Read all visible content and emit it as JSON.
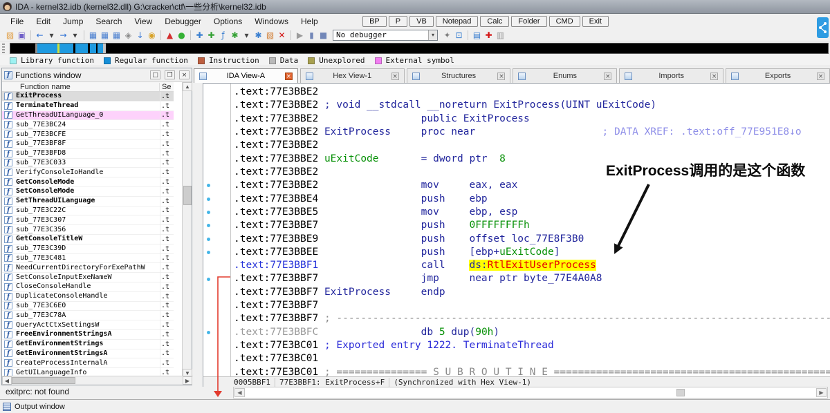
{
  "window": {
    "title": "IDA - kernel32.idb (kernel32.dll) G:\\cracker\\ctf\\一些分析\\kernel32.idb"
  },
  "menu": {
    "items": [
      "File",
      "Edit",
      "Jump",
      "Search",
      "View",
      "Debugger",
      "Options",
      "Windows",
      "Help"
    ],
    "quick_buttons": [
      "BP",
      "P",
      "VB",
      "Notepad",
      "Calc",
      "Folder",
      "CMD",
      "Exit"
    ]
  },
  "toolbar": {
    "debugger_select": "No debugger",
    "left_icons": [
      {
        "name": "open-file-icon",
        "glyph": "▨",
        "color": "#e09a3c"
      },
      {
        "name": "save-icon",
        "glyph": "▣",
        "color": "#7161c8"
      },
      {
        "sep": true
      },
      {
        "name": "navigate-back-icon",
        "glyph": "←",
        "color": "#2b6fd4"
      },
      {
        "name": "navigate-back-dropdown-icon",
        "glyph": "▾",
        "color": "#444444"
      },
      {
        "name": "navigate-forward-icon",
        "glyph": "→",
        "color": "#2b6fd4"
      },
      {
        "name": "navigate-forward-dropdown-icon",
        "glyph": "▾",
        "color": "#444444"
      },
      {
        "sep": true
      },
      {
        "name": "jump-to-address-icon",
        "glyph": "▦",
        "color": "#4a7fd0"
      },
      {
        "name": "jump-to-name-icon",
        "glyph": "▦",
        "color": "#4a7fd0"
      },
      {
        "name": "jump-to-function-icon",
        "glyph": "▦",
        "color": "#4a7fd0"
      },
      {
        "name": "jump-xref-icon",
        "glyph": "◈",
        "color": "#8a8a8a"
      },
      {
        "name": "jump-down-icon",
        "glyph": "↓",
        "color": "#2b6fd4"
      },
      {
        "name": "search-icon",
        "glyph": "◉",
        "color": "#d8a32a"
      },
      {
        "sep": true
      },
      {
        "name": "problems-icon",
        "glyph": "▲",
        "color": "#d33030"
      },
      {
        "name": "analysis-indicator-icon",
        "glyph": "●",
        "color": "#35b135"
      },
      {
        "sep": true
      },
      {
        "name": "create-struct-icon",
        "glyph": "✚",
        "color": "#3a7fd0"
      },
      {
        "name": "create-enum-icon",
        "glyph": "✚",
        "color": "#35a135"
      },
      {
        "name": "rename-icon",
        "glyph": "ƒ",
        "color": "#3a7fd0"
      },
      {
        "name": "patch-icon",
        "glyph": "✱",
        "color": "#35a135"
      },
      {
        "name": "patch-dropdown-icon",
        "glyph": "▾",
        "color": "#444444"
      },
      {
        "name": "snippets-icon",
        "glyph": "✱",
        "color": "#3a7fd0"
      },
      {
        "name": "colors-icon",
        "glyph": "▧",
        "color": "#d07a2e"
      },
      {
        "name": "undefine-icon",
        "glyph": "✕",
        "color": "#d41616"
      },
      {
        "sep": true
      },
      {
        "name": "debug-start-icon",
        "glyph": "▶",
        "color": "#9b9b9b"
      },
      {
        "name": "debug-pause-icon",
        "glyph": "▮",
        "color": "#7287b8"
      },
      {
        "name": "debug-stop-icon",
        "glyph": "■",
        "color": "#7287b8"
      }
    ],
    "right_icons": [
      {
        "name": "debugger-options-icon",
        "glyph": "✦",
        "color": "#808080"
      },
      {
        "name": "open-subviews-icon",
        "glyph": "⊡",
        "color": "#3a7fd0"
      },
      {
        "sep": true
      },
      {
        "name": "script-window-icon",
        "glyph": "▤",
        "color": "#3a7fd0"
      },
      {
        "name": "breakpoint-add-icon",
        "glyph": "✚",
        "color": "#d41616"
      },
      {
        "name": "breakpoint-remove-icon",
        "glyph": "▥",
        "color": "#9b9b9b"
      }
    ]
  },
  "legend": {
    "items": [
      {
        "label": "Library function",
        "color": "#9ef2f2"
      },
      {
        "label": "Regular function",
        "color": "#168fd8"
      },
      {
        "label": "Instruction",
        "color": "#bd5f40"
      },
      {
        "label": "Data",
        "color": "#b9b9b9"
      },
      {
        "label": "Unexplored",
        "color": "#a8a050"
      },
      {
        "label": "External symbol",
        "color": "#f27ef2"
      }
    ]
  },
  "functions_panel": {
    "title": "Functions window",
    "columns": [
      "Function name",
      "Se"
    ],
    "rows": [
      {
        "name": "ExitProcess",
        "bold": true,
        "bg": "selected",
        "seg": ".t"
      },
      {
        "name": "TerminateThread",
        "bold": true,
        "seg": ".t"
      },
      {
        "name": "GetThreadUILanguage_0",
        "bg": "pink",
        "seg": ".t"
      },
      {
        "name": "sub_77E3BC24",
        "seg": ".t"
      },
      {
        "name": "sub_77E3BCFE",
        "seg": ".t"
      },
      {
        "name": "sub_77E3BF8F",
        "seg": ".t"
      },
      {
        "name": "sub_77E3BFD8",
        "seg": ".t"
      },
      {
        "name": "sub_77E3C033",
        "seg": ".t"
      },
      {
        "name": "VerifyConsoleIoHandle",
        "seg": ".t"
      },
      {
        "name": "GetConsoleMode",
        "bold": true,
        "seg": ".t"
      },
      {
        "name": "SetConsoleMode",
        "bold": true,
        "seg": ".t"
      },
      {
        "name": "SetThreadUILanguage",
        "bold": true,
        "seg": ".t"
      },
      {
        "name": "sub_77E3C22C",
        "seg": ".t"
      },
      {
        "name": "sub_77E3C307",
        "seg": ".t"
      },
      {
        "name": "sub_77E3C356",
        "seg": ".t"
      },
      {
        "name": "GetConsoleTitleW",
        "bold": true,
        "seg": ".t"
      },
      {
        "name": "sub_77E3C39D",
        "seg": ".t"
      },
      {
        "name": "sub_77E3C481",
        "seg": ".t"
      },
      {
        "name": "NeedCurrentDirectoryForExePathW",
        "seg": ".t"
      },
      {
        "name": "SetConsoleInputExeNameW",
        "seg": ".t"
      },
      {
        "name": "CloseConsoleHandle",
        "seg": ".t"
      },
      {
        "name": "DuplicateConsoleHandle",
        "seg": ".t"
      },
      {
        "name": "sub_77E3C6E0",
        "seg": ".t"
      },
      {
        "name": "sub_77E3C78A",
        "seg": ".t"
      },
      {
        "name": "QueryActCtxSettingsW",
        "seg": ".t"
      },
      {
        "name": "FreeEnvironmentStringsA",
        "bold": true,
        "seg": ".t"
      },
      {
        "name": "GetEnvironmentStrings",
        "bold": true,
        "seg": ".t"
      },
      {
        "name": "GetEnvironmentStringsA",
        "bold": true,
        "seg": ".t"
      },
      {
        "name": "CreateProcessInternalA",
        "seg": ".t"
      },
      {
        "name": "GetUILanguageInfo",
        "seg": ".t"
      }
    ],
    "status": "exitprc: not found"
  },
  "tabs": [
    {
      "label": "IDA View-A",
      "active": true
    },
    {
      "label": "Hex View-1",
      "active": false
    },
    {
      "label": "Structures",
      "active": false
    },
    {
      "label": "Enums",
      "active": false
    },
    {
      "label": "Imports",
      "active": false
    },
    {
      "label": "Exports",
      "active": false
    }
  ],
  "disassembly": {
    "dot_lines": [
      7,
      8,
      9,
      10,
      11,
      12,
      14,
      18
    ],
    "lines": [
      [
        [
          "a",
          ".text:77E3BBE2"
        ]
      ],
      [
        [
          "a",
          ".text:77E3BBE2"
        ],
        [
          "n",
          " ; void __stdcall __noreturn ExitProcess(UINT uExitCode)"
        ]
      ],
      [
        [
          "a",
          ".text:77E3BBE2"
        ],
        [
          "n",
          "                 public ExitProcess"
        ]
      ],
      [
        [
          "a",
          ".text:77E3BBE2"
        ],
        [
          "n",
          " ExitProcess     proc near"
        ],
        [
          "x",
          "                     ; DATA XREF: .text:off_77E951E8↓o"
        ]
      ],
      [
        [
          "a",
          ".text:77E3BBE2"
        ]
      ],
      [
        [
          "a",
          ".text:77E3BBE2"
        ],
        [
          "g",
          " uExitCode"
        ],
        [
          "n",
          "       = dword ptr  "
        ],
        [
          "g",
          "8"
        ]
      ],
      [
        [
          "a",
          ".text:77E3BBE2"
        ]
      ],
      [
        [
          "a",
          ".text:77E3BBE2"
        ],
        [
          "n",
          "                 mov     eax, eax"
        ]
      ],
      [
        [
          "a",
          ".text:77E3BBE4"
        ],
        [
          "n",
          "                 push    ebp"
        ]
      ],
      [
        [
          "a",
          ".text:77E3BBE5"
        ],
        [
          "n",
          "                 mov     ebp, esp"
        ]
      ],
      [
        [
          "a",
          ".text:77E3BBE7"
        ],
        [
          "n",
          "                 push    "
        ],
        [
          "g",
          "0FFFFFFFFh"
        ]
      ],
      [
        [
          "a",
          ".text:77E3BBE9"
        ],
        [
          "n",
          "                 push    offset loc_77E8F3B0"
        ]
      ],
      [
        [
          "a",
          ".text:77E3BBEE"
        ],
        [
          "n",
          "                 push    [ebp+"
        ],
        [
          "g",
          "uExitCode"
        ],
        [
          "n",
          "]"
        ]
      ],
      [
        [
          "ab",
          ".text:77E3BBF1"
        ],
        [
          "n",
          "                 call    "
        ],
        [
          "nh",
          "ds:"
        ],
        [
          "rh",
          "RtlExitUserProcess"
        ]
      ],
      [
        [
          "a",
          ".text:77E3BBF7"
        ],
        [
          "n",
          "                 jmp     near ptr byte_77E4A0A8"
        ]
      ],
      [
        [
          "a",
          ".text:77E3BBF7"
        ],
        [
          "n",
          " ExitProcess     endp"
        ]
      ],
      [
        [
          "a",
          ".text:77E3BBF7"
        ]
      ],
      [
        [
          "a",
          ".text:77E3BBF7"
        ],
        [
          "gr",
          " ; ------------------------------------------------------------------------------------"
        ]
      ],
      [
        [
          "ag",
          ".text:77E3BBFC"
        ],
        [
          "n",
          "                 db "
        ],
        [
          "g",
          "5"
        ],
        [
          "n",
          " dup("
        ],
        [
          "g",
          "90h"
        ],
        [
          "n",
          ")"
        ]
      ],
      [
        [
          "a",
          ".text:77E3BC01"
        ],
        [
          "c",
          " ; Exported entry 1222. TerminateThread"
        ]
      ],
      [
        [
          "a",
          ".text:77E3BC01"
        ]
      ],
      [
        [
          "a",
          ".text:77E3BC01"
        ],
        [
          "gr",
          " ; =============== S U B R O U T I N E ==============================================="
        ]
      ]
    ]
  },
  "status_bar": {
    "cells": [
      "0005BBF1",
      "77E3BBF1: ExitProcess+F",
      "(Synchronized with Hex View-1)"
    ]
  },
  "annotation": {
    "text": "ExitProcess调用的是这个函数"
  },
  "output_window": {
    "title": "Output window"
  }
}
